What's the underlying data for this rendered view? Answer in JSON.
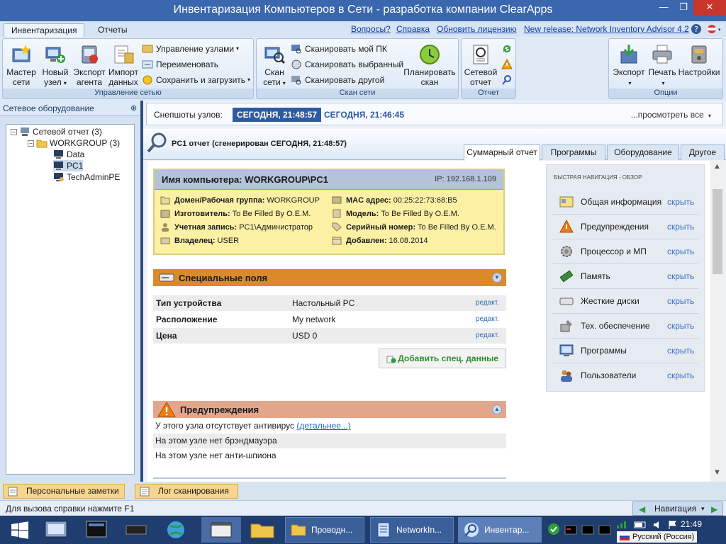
{
  "window": {
    "title": "Инвентаризация Компьютеров в Сети - разработка компании ClearApps",
    "controls": [
      "minimize",
      "maximize",
      "close"
    ]
  },
  "menu": {
    "tabs": [
      "Инвентаризация",
      "Отчеты"
    ],
    "links": [
      "Вопросы?",
      "Справка",
      "Обновить лицензию",
      "New release: Network Inventory Advisor 4.2"
    ]
  },
  "ribbon": {
    "group1": {
      "title": "Управление сетью",
      "big": [
        "Мастер\nсети",
        "Новый\nузел",
        "Экспорт\nагента",
        "Импорт\nданных"
      ],
      "small": [
        "Управление узлами",
        "Переименовать",
        "Сохранить и загрузить"
      ]
    },
    "group2": {
      "title": "Скан сети",
      "big": [
        "Скан\nсети",
        "Планировать\nскан"
      ],
      "small": [
        "Сканировать мой ПК",
        "Сканировать выбранный",
        "Сканировать другой"
      ]
    },
    "group3": {
      "title": "Отчет",
      "big": [
        "Сетевой\nотчет"
      ]
    },
    "group4": {
      "title": "Опции",
      "big": [
        "Экспорт",
        "Печать",
        "Настройки"
      ]
    }
  },
  "left_panel": {
    "title": "Сетевое оборудование",
    "tree": [
      {
        "label": "Сетевой отчет (3)"
      },
      {
        "label": "WORKGROUP (3)"
      },
      {
        "label": "Data"
      },
      {
        "label": "PC1"
      },
      {
        "label": "TechAdminPE"
      }
    ]
  },
  "snapshots": {
    "label": "Снепшоты узлов:",
    "active": "СЕГОДНЯ, 21:48:57",
    "other": "СЕГОДНЯ, 21:46:45",
    "view_all": "...просмотреть все"
  },
  "report": {
    "title": "PC1 отчет (сгенерирован СЕГОДНЯ, 21:48:57)",
    "tabs": [
      "Суммарный отчет",
      "Программы",
      "Оборудование",
      "Другое"
    ]
  },
  "computer": {
    "name": "Имя компьютера: WORKGROUP\\PC1",
    "ip": "IP: 192.168.1.109",
    "left": [
      {
        "k": "Домен/Рабочая группа:",
        "v": "WORKGROUP"
      },
      {
        "k": "Изготовитель:",
        "v": "To Be Filled By O.E.M."
      },
      {
        "k": "Учетная запись:",
        "v": "PC1\\Администратор"
      },
      {
        "k": "Владелец:",
        "v": "USER"
      }
    ],
    "right": [
      {
        "k": "MAC адрес:",
        "v": "00:25:22:73:68:B5"
      },
      {
        "k": "Модель:",
        "v": "To Be Filled By O.E.M."
      },
      {
        "k": "Серийный номер:",
        "v": "To Be Filled By O.E.M."
      },
      {
        "k": "Добавлен:",
        "v": "16.08.2014"
      }
    ]
  },
  "special": {
    "title": "Специальные поля",
    "rows": [
      {
        "name": "Тип устройства",
        "value": "Настольный PC",
        "edit": "редакт."
      },
      {
        "name": "Расположение",
        "value": "My network",
        "edit": "редакт."
      },
      {
        "name": "Цена",
        "value": "USD 0",
        "edit": "редакт."
      }
    ],
    "add_button": "Добавить спец. данные"
  },
  "warnings": {
    "title": "Предупреждения",
    "rows": [
      {
        "text": "У этого узла отсутствует антивирус ",
        "link": "(детальнее...)"
      },
      {
        "text": "На этом узле нет брэндмауэра"
      },
      {
        "text": "На этом узле нет анти-шпиона"
      }
    ]
  },
  "quick_nav": {
    "title": "БЫСТРАЯ НАВИГАЦИЯ - ОБЗОР",
    "items": [
      {
        "label": "Общая информация",
        "action": "скрыть",
        "icon": "general-info-icon"
      },
      {
        "label": "Предупреждения",
        "action": "скрыть",
        "icon": "warning-icon"
      },
      {
        "label": "Процессор и МП",
        "action": "скрыть",
        "icon": "processor-icon"
      },
      {
        "label": "Память",
        "action": "скрыть",
        "icon": "memory-icon"
      },
      {
        "label": "Жесткие диски",
        "action": "скрыть",
        "icon": "hard-disk-icon"
      },
      {
        "label": "Тех. обеспечение",
        "action": "скрыть",
        "icon": "hardware-icon"
      },
      {
        "label": "Программы",
        "action": "скрыть",
        "icon": "programs-icon"
      },
      {
        "label": "Пользователи",
        "action": "скрыть",
        "icon": "users-icon"
      }
    ]
  },
  "bottom": {
    "tabs": [
      "Персональные заметки",
      "Лог сканирования"
    ],
    "status": "Для вызова справки нажмите F1",
    "nav": "Навигация"
  },
  "taskbar": {
    "windows": [
      "Проводн...",
      "NetworkIn...",
      "Инвентар..."
    ],
    "time": "21:49",
    "language": "Русский (Россия)"
  },
  "colors": {
    "accent": "#3a67ad",
    "special_bar": "#d98b2b",
    "warning_bar": "#e3a68a",
    "info_bg": "#fbf0a4"
  }
}
